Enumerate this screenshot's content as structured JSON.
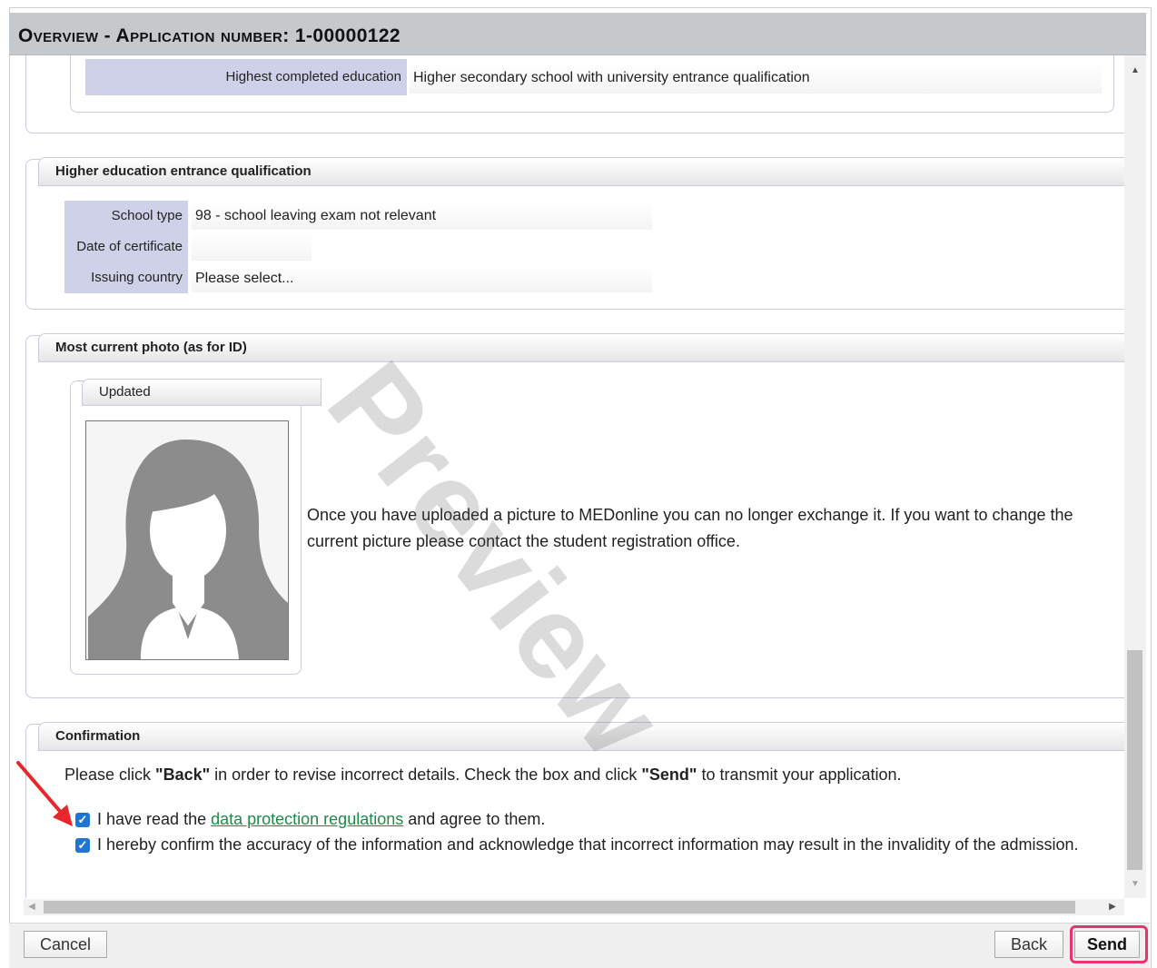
{
  "window": {
    "title": "Overview - Application number: 1-00000122"
  },
  "education": {
    "label": "Highest completed education",
    "value": "Higher secondary school with university entrance qualification"
  },
  "entrance_qualification": {
    "legend": "Higher education entrance qualification",
    "school_type_label": "School type",
    "school_type_value": "98 - school leaving exam not relevant",
    "date_label": "Date of certificate",
    "date_value": "",
    "country_label": "Issuing country",
    "country_value": "Please select..."
  },
  "photo": {
    "legend": "Most current photo (as for ID)",
    "status_legend": "Updated",
    "info_line1": "Once you have uploaded a picture to MEDonline you can no longer exchange it. If you want to change the",
    "info_line2": "current picture please contact the student registration office."
  },
  "watermark": "Preview",
  "confirmation": {
    "legend": "Confirmation",
    "instr_part1": "Please click ",
    "instr_back": "\"Back\"",
    "instr_part2": " in order to revise incorrect details. Check the box and click ",
    "instr_send": "\"Send\"",
    "instr_part3": " to transmit your application.",
    "check1_pre": "I have read the ",
    "check1_link": "data protection regulations",
    "check1_post": " and agree to them.",
    "check1_checked": true,
    "check2_text": "I hereby confirm the accuracy of the information and acknowledge that incorrect information may result in the invalidity of the admission.",
    "check2_checked": true
  },
  "buttons": {
    "cancel": "Cancel",
    "back": "Back",
    "send": "Send"
  },
  "colors": {
    "highlight": "#e8336f",
    "arrow": "#e8262c",
    "link": "#1e8a47",
    "checkbox": "#1f76d2",
    "label_bg": "#cfd1e8",
    "title_bg": "#c6c9cc"
  }
}
